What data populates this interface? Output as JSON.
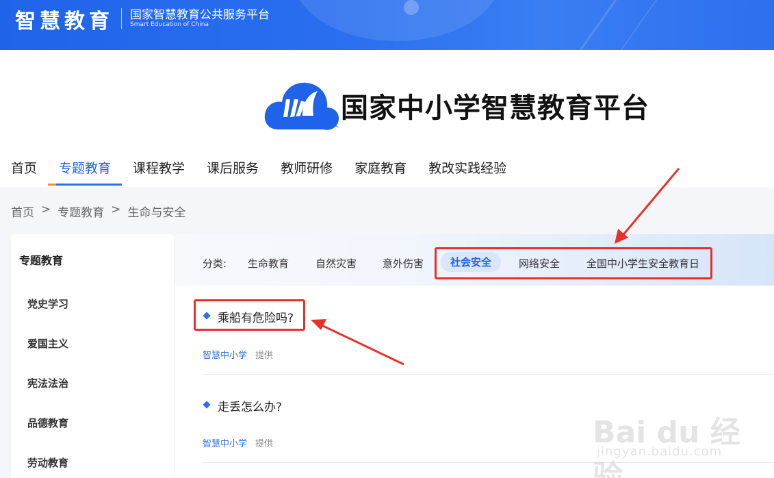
{
  "topbar": {
    "brand_cn": "智慧教育",
    "title": "国家智慧教育公共服务平台",
    "subtitle_en": "Smart Education of China"
  },
  "header": {
    "logo_text": "国家中小学智慧教育平台"
  },
  "nav": {
    "items": [
      {
        "label": "首页"
      },
      {
        "label": "专题教育",
        "active": true
      },
      {
        "label": "课程教学"
      },
      {
        "label": "课后服务"
      },
      {
        "label": "教师研修"
      },
      {
        "label": "家庭教育"
      },
      {
        "label": "教改实践经验"
      }
    ]
  },
  "breadcrumb": {
    "items": [
      "首页",
      "专题教育",
      "生命与安全"
    ],
    "separator": ">"
  },
  "sidebar": {
    "title": "专题教育",
    "items": [
      "党史学习",
      "爱国主义",
      "宪法法治",
      "品德教育",
      "劳动教育"
    ]
  },
  "categories": {
    "label": "分类:",
    "items": [
      "生命教育",
      "自然灾害",
      "意外伤害",
      "社会安全",
      "网络安全",
      "全国中小学生安全教育日"
    ],
    "active": "社会安全"
  },
  "articles": [
    {
      "title": "乘船有危险吗?",
      "source": "智慧中小学",
      "provide": "提供"
    },
    {
      "title": "走丢怎么办?",
      "source": "智慧中小学",
      "provide": "提供"
    }
  ],
  "watermark": {
    "text": "Bai du 经验",
    "url": "jingyan.baidu.com"
  },
  "colors": {
    "brand_blue": "#1f63ea",
    "annotation_red": "#e8302a",
    "active_orange": "#ff8a2a"
  }
}
